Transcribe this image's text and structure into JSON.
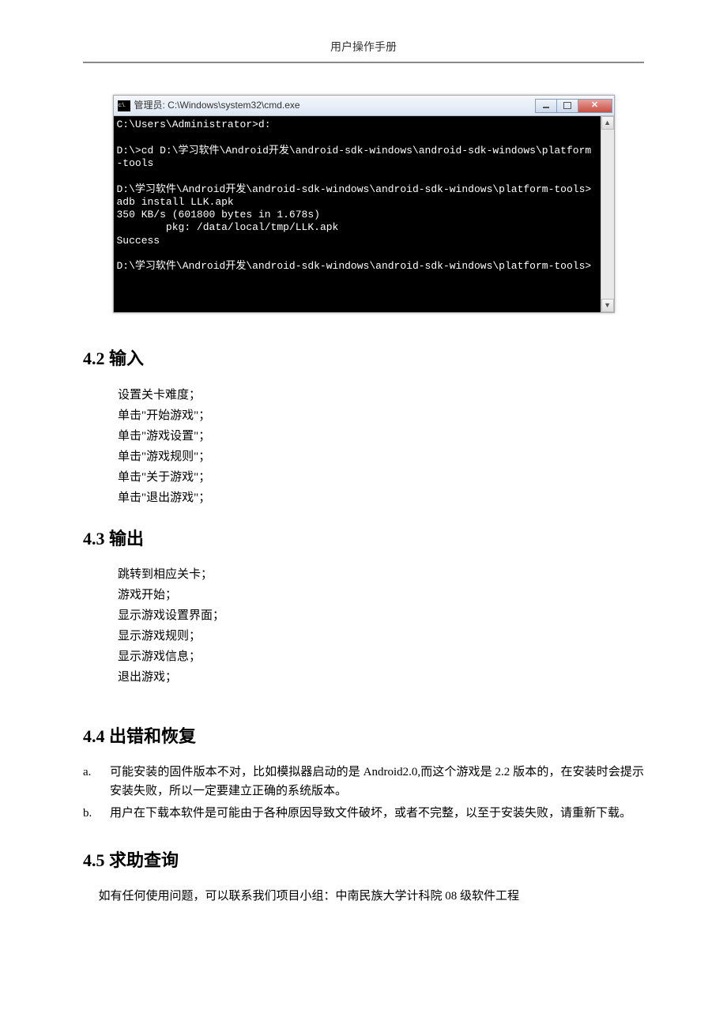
{
  "header": {
    "title": "用户操作手册"
  },
  "cmd": {
    "title": "管理员: C:\\Windows\\system32\\cmd.exe",
    "body": "C:\\Users\\Administrator>d:\n\nD:\\>cd D:\\学习软件\\Android开发\\android-sdk-windows\\android-sdk-windows\\platform-tools\n\nD:\\学习软件\\Android开发\\android-sdk-windows\\android-sdk-windows\\platform-tools>adb install LLK.apk\n350 KB/s (601800 bytes in 1.678s)\n        pkg: /data/local/tmp/LLK.apk\nSuccess\n\nD:\\学习软件\\Android开发\\android-sdk-windows\\android-sdk-windows\\platform-tools>"
  },
  "sections": {
    "s42": {
      "title": "4.2 输入",
      "items": [
        "设置关卡难度；",
        "单击\"开始游戏\"；",
        "单击\"游戏设置\"；",
        "单击\"游戏规则\"；",
        "单击\"关于游戏\"；",
        "单击\"退出游戏\"；"
      ]
    },
    "s43": {
      "title": "4.3 输出",
      "items": [
        "跳转到相应关卡；",
        "游戏开始；",
        "显示游戏设置界面；",
        "显示游戏规则；",
        "显示游戏信息；",
        "退出游戏；"
      ]
    },
    "s44": {
      "title": "4.4 出错和恢复",
      "items": [
        {
          "marker": "a.",
          "text": "可能安装的固件版本不对，比如模拟器启动的是 Android2.0,而这个游戏是 2.2 版本的，在安装时会提示安装失败，所以一定要建立正确的系统版本。"
        },
        {
          "marker": "b.",
          "text": "用户在下载本软件是可能由于各种原因导致文件破坏，或者不完整，以至于安装失败，请重新下载。"
        }
      ]
    },
    "s45": {
      "title": "4.5 求助查询",
      "para": "如有任何使用问题，可以联系我们项目小组：中南民族大学计科院 08 级软件工程"
    }
  }
}
